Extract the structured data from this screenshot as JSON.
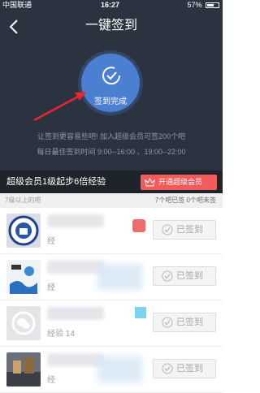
{
  "status_bar": {
    "carrier": "中国联通",
    "time": "16:27",
    "battery": "57%"
  },
  "nav": {
    "title": "一键签到"
  },
  "sign_circle": {
    "label": "签到完成"
  },
  "hints": {
    "line1": "让签到更容易些吧! 加入超级会员可签200个吧",
    "line2": "每日最佳签到时间  9:00--16:00 、19:00--22:00"
  },
  "promo": {
    "text": "超级会员1级起步6倍经验",
    "button": "开通超级会员"
  },
  "section": {
    "left": "7级以上的吧",
    "right": "7个吧已签   0个吧未签"
  },
  "forums": [
    {
      "exp": "经",
      "button": "已签到"
    },
    {
      "exp": "经",
      "button": "已签到"
    },
    {
      "exp": "经验  14",
      "button": "已签到"
    },
    {
      "exp": "经",
      "button": "已签到"
    }
  ],
  "colors": {
    "header_bg": "#2b3340",
    "circle": "#4a7fd1",
    "promo_button": "#f25b5b",
    "arrow": "#e8262b"
  }
}
